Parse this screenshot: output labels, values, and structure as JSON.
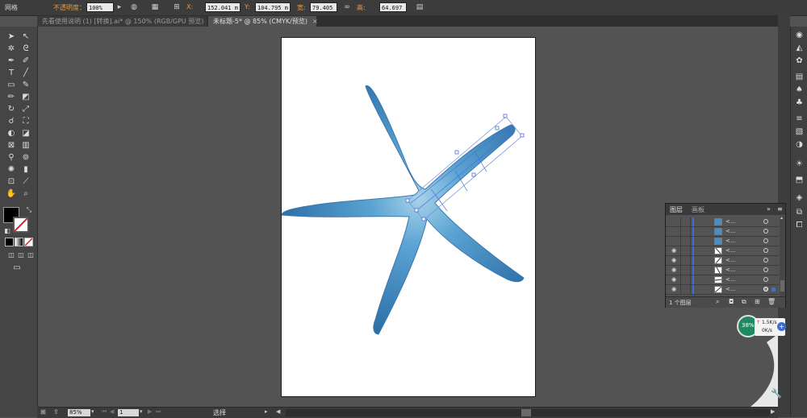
{
  "control_bar": {
    "mode_label": "网格",
    "opacity_label": "不透明度：",
    "opacity_value": "100%",
    "x_label": "X:",
    "x_value": "152.041 m",
    "y_label": "Y:",
    "y_value": "104.795 m",
    "w_label": "宽:",
    "w_value": "79.405 mm",
    "h_label": "高:",
    "h_value": "64.697 mm"
  },
  "tabs": [
    {
      "label": "先看使用说明 (1) [转换].ai* @ 150% (RGB/GPU 预览)",
      "active": false
    },
    {
      "label": "未标题-5* @ 85% (CMYK/预览)",
      "active": true
    }
  ],
  "tab_close_glyph": "×",
  "layers_panel": {
    "tabs": [
      "图层",
      "画板"
    ],
    "rows": [
      {
        "name": "<...",
        "visible": false,
        "thumb": "blue"
      },
      {
        "name": "<...",
        "visible": false,
        "thumb": "blue"
      },
      {
        "name": "<...",
        "visible": false,
        "thumb": "blue"
      },
      {
        "name": "<...",
        "visible": true,
        "thumb": "line"
      },
      {
        "name": "<...",
        "visible": true,
        "thumb": "line"
      },
      {
        "name": "<...",
        "visible": true,
        "thumb": "line"
      },
      {
        "name": "<...",
        "visible": true,
        "thumb": "line"
      },
      {
        "name": "<...",
        "visible": true,
        "thumb": "line"
      }
    ],
    "footer_label": "1 个图层"
  },
  "status_bar": {
    "zoom_value": "85%",
    "page_value": "1",
    "tool_label": "选择"
  },
  "net_widget": {
    "percent": "38%",
    "up_speed": "1.5K/s",
    "down_speed": "0K/s"
  },
  "colors": {
    "accent_blue": "#3b6fd0",
    "star_blue": "#3d8cc4"
  }
}
